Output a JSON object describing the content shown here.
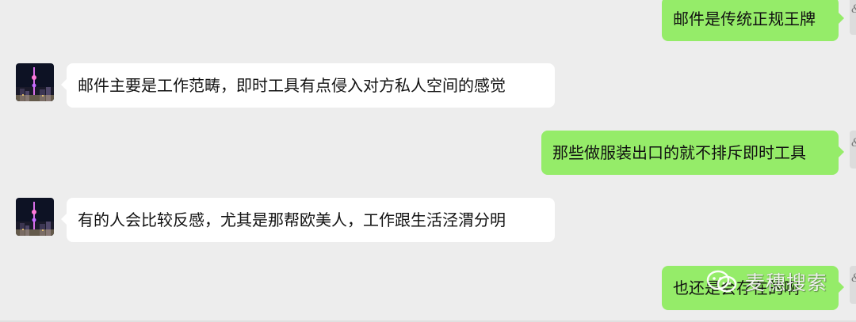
{
  "messages": [
    {
      "side": "out",
      "text": "邮件是传统正规王牌"
    },
    {
      "side": "in",
      "text": "邮件主要是工作范畴，即时工具有点侵入对方私人空间的感觉"
    },
    {
      "side": "out",
      "text": "那些做服装出口的就不排斥即时工具"
    },
    {
      "side": "in",
      "text": "有的人会比较反感，尤其是那帮欧美人，工作跟生活泾渭分明"
    },
    {
      "side": "out",
      "text": "也还是会存在的啊"
    }
  ],
  "watermark": {
    "text": "麦穗搜索"
  },
  "colors": {
    "background": "#ededed",
    "incoming_bubble": "#ffffff",
    "outgoing_bubble": "#95ec69",
    "text": "#111111"
  },
  "icons": {
    "contact_avatar": "night-city-tower-photo",
    "self_avatar": "partial-user-avatar",
    "watermark": "wechat-logo-icon"
  }
}
